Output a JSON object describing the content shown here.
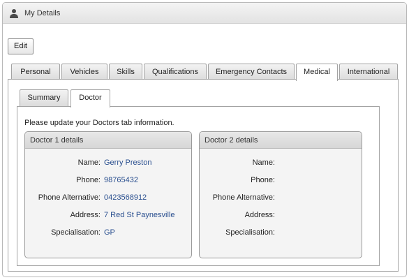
{
  "panel": {
    "title": "My Details",
    "icon": "user-icon"
  },
  "toolbar": {
    "edit_label": "Edit"
  },
  "tabs": [
    {
      "label": "Personal",
      "active": false
    },
    {
      "label": "Vehicles",
      "active": false
    },
    {
      "label": "Skills",
      "active": false
    },
    {
      "label": "Qualifications",
      "active": false
    },
    {
      "label": "Emergency Contacts",
      "active": false
    },
    {
      "label": "Medical",
      "active": true
    },
    {
      "label": "International",
      "active": false
    }
  ],
  "subtabs": [
    {
      "label": "Summary",
      "active": false
    },
    {
      "label": "Doctor",
      "active": true
    }
  ],
  "info_text": "Please update your Doctors tab information.",
  "doctors": [
    {
      "title": "Doctor 1 details",
      "fields": [
        {
          "label": "Name:",
          "value": "Gerry Preston"
        },
        {
          "label": "Phone:",
          "value": "98765432"
        },
        {
          "label": "Phone Alternative:",
          "value": "0423568912"
        },
        {
          "label": "Address:",
          "value": "7 Red St Paynesville"
        },
        {
          "label": "Specialisation:",
          "value": "GP"
        }
      ]
    },
    {
      "title": "Doctor 2 details",
      "fields": [
        {
          "label": "Name:",
          "value": ""
        },
        {
          "label": "Phone:",
          "value": ""
        },
        {
          "label": "Phone Alternative:",
          "value": ""
        },
        {
          "label": "Address:",
          "value": ""
        },
        {
          "label": "Specialisation:",
          "value": ""
        }
      ]
    }
  ],
  "colors": {
    "value_text": "#2a4f8f",
    "header_bg": "#e3e3e3",
    "border": "#a3a3a3"
  }
}
